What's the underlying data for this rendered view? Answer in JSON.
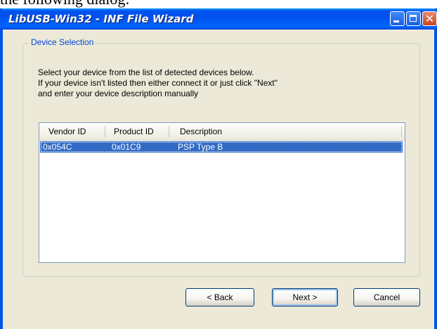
{
  "page": {
    "caption_fragment": "the following dialog:"
  },
  "window": {
    "title": "LibUSB-Win32 - INF File Wizard",
    "close_glyph": "✕"
  },
  "group": {
    "legend": "Device Selection",
    "instructions": [
      "Select your device from the list of detected devices below.",
      "If your device isn't listed then either connect it or just click \"Next\"",
      "and enter your device description manually"
    ]
  },
  "devices": {
    "columns": [
      "Vendor ID",
      "Product ID",
      "Description"
    ],
    "rows": [
      {
        "vendor_id": "0x054C",
        "product_id": "0x01C9",
        "description": "PSP Type B",
        "selected": true
      }
    ]
  },
  "buttons": {
    "back": "< Back",
    "next": "Next >",
    "cancel": "Cancel"
  },
  "colors": {
    "titlebar": "#0054e3",
    "dialog_bg": "#ece9d8",
    "selection": "#316ac5",
    "group_legend": "#0046d5"
  }
}
